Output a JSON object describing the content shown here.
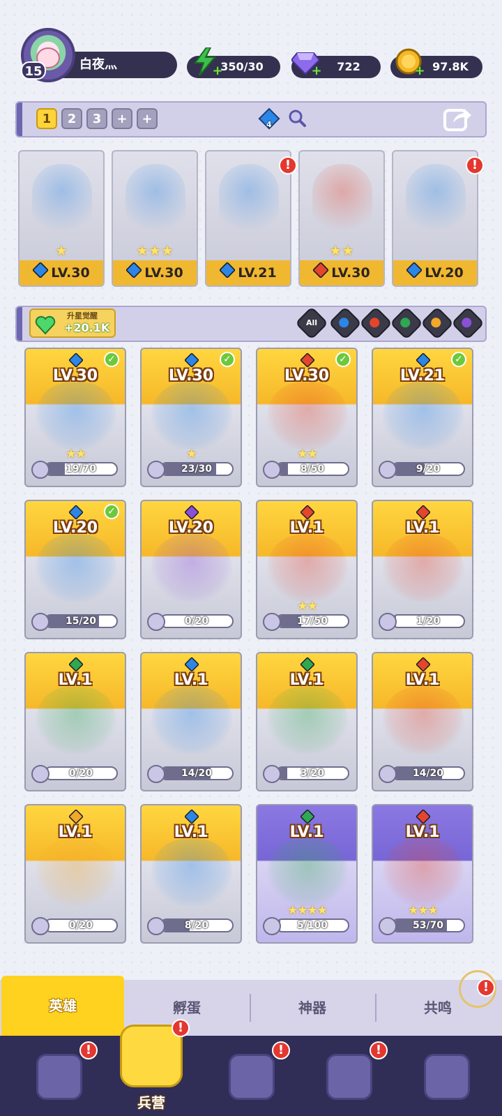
{
  "player": {
    "level": "15",
    "name": "白夜灬"
  },
  "resources": [
    {
      "name": "energy",
      "icon": "lightning-icon",
      "value": "350/30",
      "color": "#3cc14a"
    },
    {
      "name": "gems",
      "icon": "diamond-icon",
      "value": "722",
      "color": "#8d6bea"
    },
    {
      "name": "coins",
      "icon": "coin-icon",
      "value": "97.8K",
      "color": "#f3b728"
    }
  ],
  "team_slots": [
    "1",
    "2",
    "3",
    "+",
    "+"
  ],
  "team_badge_count": "4",
  "team": [
    {
      "level": "LV.30",
      "element": "water",
      "stars": 1
    },
    {
      "level": "LV.30",
      "element": "water",
      "stars": 3
    },
    {
      "level": "LV.21",
      "element": "water",
      "stars": 0
    },
    {
      "level": "LV.30",
      "element": "fire",
      "stars": 2
    },
    {
      "level": "LV.20",
      "element": "water",
      "stars": 0
    }
  ],
  "awaken": {
    "title": "升星觉醒",
    "value": "+20.1K"
  },
  "filters": [
    "All",
    "water",
    "fire",
    "nature",
    "light",
    "dark"
  ],
  "heroes": [
    {
      "level": "LV.30",
      "element": "water",
      "shards": "19/70",
      "progress": 0.27,
      "checked": true,
      "stars": 2,
      "rarity": "gold"
    },
    {
      "level": "LV.30",
      "element": "water",
      "shards": "23/30",
      "progress": 0.77,
      "checked": true,
      "stars": 1,
      "rarity": "gold"
    },
    {
      "level": "LV.30",
      "element": "fire",
      "shards": "8/50",
      "progress": 0.16,
      "checked": true,
      "stars": 2,
      "rarity": "gold"
    },
    {
      "level": "LV.21",
      "element": "water",
      "shards": "9/20",
      "progress": 0.45,
      "checked": true,
      "stars": 0,
      "rarity": "gold"
    },
    {
      "level": "LV.20",
      "element": "water",
      "shards": "15/20",
      "progress": 0.75,
      "checked": true,
      "stars": 0,
      "rarity": "gold"
    },
    {
      "level": "LV.20",
      "element": "dark",
      "shards": "0/20",
      "progress": 0,
      "checked": false,
      "stars": 0,
      "rarity": "gold"
    },
    {
      "level": "LV.1",
      "element": "fire",
      "shards": "17/50",
      "progress": 0.34,
      "checked": false,
      "stars": 2,
      "rarity": "gold"
    },
    {
      "level": "LV.1",
      "element": "fire",
      "shards": "1/20",
      "progress": 0.05,
      "checked": false,
      "stars": 0,
      "rarity": "gold"
    },
    {
      "level": "LV.1",
      "element": "nature",
      "shards": "0/20",
      "progress": 0,
      "checked": false,
      "stars": 0,
      "rarity": "gold"
    },
    {
      "level": "LV.1",
      "element": "water",
      "shards": "14/20",
      "progress": 0.7,
      "checked": false,
      "stars": 0,
      "rarity": "gold"
    },
    {
      "level": "LV.1",
      "element": "nature",
      "shards": "3/20",
      "progress": 0.15,
      "checked": false,
      "stars": 0,
      "rarity": "gold"
    },
    {
      "level": "LV.1",
      "element": "fire",
      "shards": "14/20",
      "progress": 0.7,
      "checked": false,
      "stars": 0,
      "rarity": "gold"
    },
    {
      "level": "LV.1",
      "element": "light",
      "shards": "0/20",
      "progress": 0,
      "checked": false,
      "stars": 0,
      "rarity": "gold"
    },
    {
      "level": "LV.1",
      "element": "water",
      "shards": "8/20",
      "progress": 0.4,
      "checked": false,
      "stars": 0,
      "rarity": "gold"
    },
    {
      "level": "LV.1",
      "element": "nature",
      "shards": "5/100",
      "progress": 0.05,
      "checked": false,
      "stars": 4,
      "rarity": "purple"
    },
    {
      "level": "LV.1",
      "element": "fire",
      "shards": "53/70",
      "progress": 0.76,
      "checked": false,
      "stars": 3,
      "rarity": "purple"
    }
  ],
  "subtabs": [
    "英雄",
    "孵蛋",
    "神器",
    "共鸣"
  ],
  "nav": [
    {
      "label": "",
      "icon": "cards-icon",
      "badge": "!"
    },
    {
      "label": "兵营",
      "icon": "barracks-icon",
      "badge": "!"
    },
    {
      "label": "",
      "icon": "map-icon",
      "badge": "!"
    },
    {
      "label": "",
      "icon": "shop-icon",
      "badge": "!"
    },
    {
      "label": "",
      "icon": "guild-icon",
      "badge": ""
    }
  ],
  "element_colors": {
    "water": "#2b86e6",
    "fire": "#e5452c",
    "nature": "#2fa852",
    "light": "#f2a82a",
    "dark": "#8b4fd8"
  }
}
